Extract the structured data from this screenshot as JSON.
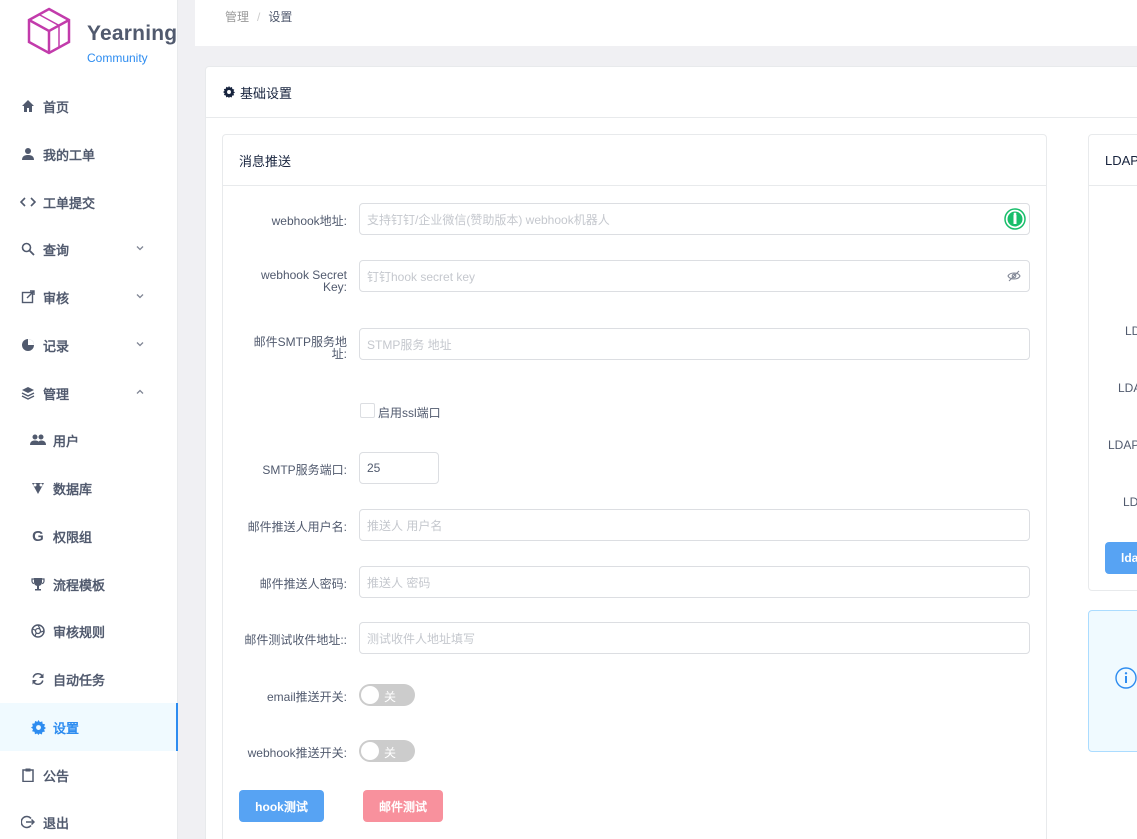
{
  "sidebar": {
    "brand": "Yearning",
    "brand_sub": "Community",
    "items": [
      {
        "label": "首页",
        "icon": "home-icon"
      },
      {
        "label": "我的工单",
        "icon": "person-icon"
      },
      {
        "label": "工单提交",
        "icon": "code-icon"
      },
      {
        "label": "查询",
        "icon": "search-icon",
        "expand": "down"
      },
      {
        "label": "审核",
        "icon": "external-link-icon",
        "expand": "down"
      },
      {
        "label": "记录",
        "icon": "pie-chart-icon",
        "expand": "down"
      },
      {
        "label": "管理",
        "icon": "layers-icon",
        "expand": "up"
      },
      {
        "label": "用户",
        "icon": "people-icon"
      },
      {
        "label": "数据库",
        "icon": "database-icon"
      },
      {
        "label": "权限组",
        "icon": "g-icon"
      },
      {
        "label": "流程模板",
        "icon": "trophy-icon"
      },
      {
        "label": "审核规则",
        "icon": "aperture-icon"
      },
      {
        "label": "自动任务",
        "icon": "refresh-icon"
      },
      {
        "label": "设置",
        "icon": "gear-icon",
        "active": true
      },
      {
        "label": "公告",
        "icon": "clipboard-icon"
      },
      {
        "label": "退出",
        "icon": "logout-icon"
      }
    ]
  },
  "breadcrumb": {
    "parent": "管理",
    "separator": "/",
    "current": "设置"
  },
  "card": {
    "title": "基础设置"
  },
  "message_panel": {
    "title": "消息推送",
    "webhook_label": "webhook地址:",
    "webhook_placeholder": "支持钉钉/企业微信(赞助版本) webhook机器人",
    "secret_label_1": "webhook Secret",
    "secret_label_2": "Key:",
    "secret_placeholder": "钉钉hook secret key",
    "smtp_host_label_1": "邮件SMTP服务地",
    "smtp_host_label_2": "址:",
    "smtp_host_placeholder": "STMP服务 地址",
    "ssl_label": "启用ssl端口",
    "smtp_port_label": "SMTP服务端口:",
    "smtp_port_value": "25",
    "sender_user_label": "邮件推送人用户名:",
    "sender_user_placeholder": "推送人 用户名",
    "sender_pwd_label": "邮件推送人密码:",
    "sender_pwd_placeholder": "推送人 密码",
    "test_addr_label": "邮件测试收件地址::",
    "test_addr_placeholder": "测试收件人地址填写",
    "email_switch_label": "email推送开关:",
    "email_switch_state": "关",
    "webhook_switch_label": "webhook推送开关:",
    "webhook_switch_state": "关",
    "hook_test_button": "hook测试",
    "mail_test_button": "邮件测试"
  },
  "ldap_panel": {
    "title": "LDAP",
    "row_labels": [
      "LD",
      "LDA",
      "LDAP",
      "LD"
    ],
    "button": "lda"
  },
  "colors": {
    "accent": "#2d8cf0",
    "primary_button": "#57a3f3",
    "danger_button": "#f8919d",
    "logo": "#c23bab"
  }
}
